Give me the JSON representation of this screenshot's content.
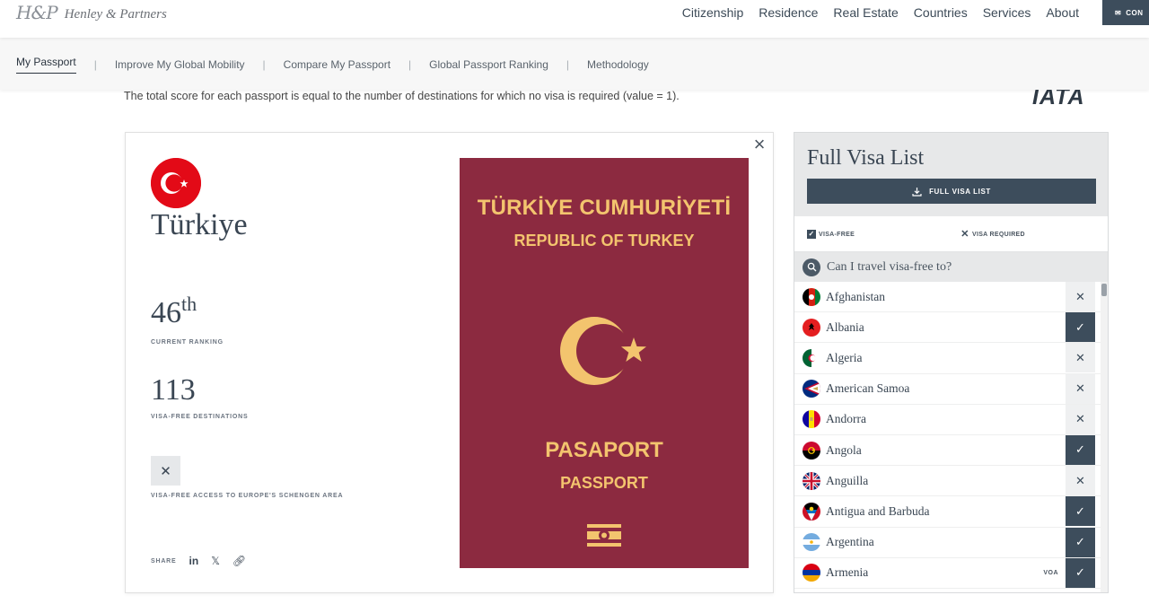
{
  "header": {
    "logo_mark": "H&P",
    "logo_text": "Henley & Partners",
    "nav": [
      "Citizenship",
      "Residence",
      "Real Estate",
      "Countries",
      "Services",
      "About"
    ],
    "contact_label": "CON"
  },
  "subnav": {
    "items": [
      "My Passport",
      "Improve My Global Mobility",
      "Compare My Passport",
      "Global Passport Ranking",
      "Methodology"
    ],
    "active_index": 0
  },
  "score_note": "The total score for each passport is equal to the number of destinations for which no visa is required (value = 1).",
  "iata_logo": "IATA",
  "passport": {
    "country": "Türkiye",
    "ranking_number": "46",
    "ranking_suffix": "th",
    "ranking_label": "CURRENT RANKING",
    "visa_free_count": "113",
    "visa_free_label": "VISA-FREE DESTINATIONS",
    "schengen_label": "VISA-FREE ACCESS TO EUROPE'S SCHENGEN AREA",
    "schengen_access": false,
    "share_label": "SHARE",
    "cover": {
      "line1": "TÜRKİYE CUMHURİYETİ",
      "line2": "REPUBLIC OF TURKEY",
      "line3": "PASAPORT",
      "line4": "PASSPORT",
      "cover_color": "#8c2a40",
      "ink_color": "#f3c46e"
    }
  },
  "visa_panel": {
    "title": "Full Visa List",
    "download_label": "FULL VISA LIST",
    "legend_free": "VISA-FREE",
    "legend_required": "VISA REQUIRED",
    "search_placeholder": "Can I travel visa-free to?",
    "countries": [
      {
        "name": "Afghanistan",
        "visa_free": false,
        "note": ""
      },
      {
        "name": "Albania",
        "visa_free": true,
        "note": ""
      },
      {
        "name": "Algeria",
        "visa_free": false,
        "note": ""
      },
      {
        "name": "American Samoa",
        "visa_free": false,
        "note": ""
      },
      {
        "name": "Andorra",
        "visa_free": false,
        "note": ""
      },
      {
        "name": "Angola",
        "visa_free": true,
        "note": ""
      },
      {
        "name": "Anguilla",
        "visa_free": false,
        "note": ""
      },
      {
        "name": "Antigua and Barbuda",
        "visa_free": true,
        "note": ""
      },
      {
        "name": "Argentina",
        "visa_free": true,
        "note": ""
      },
      {
        "name": "Armenia",
        "visa_free": true,
        "note": "VOA"
      }
    ]
  },
  "colors": {
    "primary": "#3d4d5c",
    "turkey_red": "#e30a17"
  }
}
